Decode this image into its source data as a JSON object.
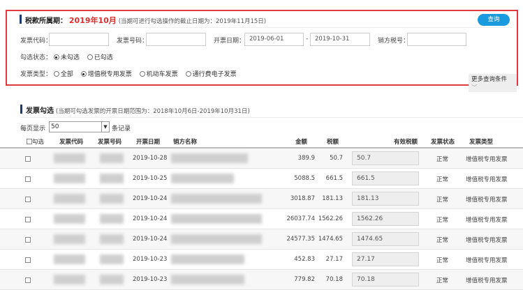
{
  "query_panel": {
    "title": "税款所属期：",
    "period": "2019年10月",
    "deadline_note": "(当期可进行勾选操作的截止日期为：2019年11月15日)",
    "query_button": "查询",
    "invoice_code_label": "发票代码：",
    "invoice_code_value": "",
    "invoice_number_label": "发票号码：",
    "invoice_number_value": "",
    "issue_date_label": "开票日期：",
    "date_from": "2019-06-01",
    "date_sep": "-",
    "date_to": "2019-10-31",
    "seller_tax_id_label": "销方税号：",
    "seller_tax_id_value": "",
    "check_status_label": "勾选状态：",
    "check_status_options": [
      "未勾选",
      "已勾选"
    ],
    "check_status_selected": "未勾选",
    "invoice_type_label": "发票类型：",
    "invoice_type_options": [
      "全部",
      "增值税专用发票",
      "机动车发票",
      "通行费电子发票"
    ],
    "invoice_type_selected": "增值税专用发票",
    "more_conditions": "更多查询条件"
  },
  "list_section": {
    "title": "发票勾选",
    "range_note": "(当期可勾选发票的开票日期范围为：2018年10月6日-2019年10月31日)",
    "page_size_prefix": "每页显示",
    "page_size": "50",
    "page_size_suffix": "条记录",
    "columns": [
      "勾选",
      "发票代码",
      "发票号码",
      "开票日期",
      "销方名称",
      "金额",
      "税额",
      "有效税额",
      "发票状态",
      "发票类型"
    ],
    "rows": [
      {
        "date": "2019-10-28",
        "amount": "389.9",
        "tax": "50.7",
        "effective_tax": "50.7",
        "status": "正常",
        "type": "增值税专用发票"
      },
      {
        "date": "2019-10-25",
        "amount": "5088.5",
        "tax": "661.5",
        "effective_tax": "661.5",
        "status": "正常",
        "type": "增值税专用发票"
      },
      {
        "date": "2019-10-24",
        "amount": "3018.87",
        "tax": "181.13",
        "effective_tax": "181.13",
        "status": "正常",
        "type": "增值税专用发票"
      },
      {
        "date": "2019-10-24",
        "amount": "26037.74",
        "tax": "1562.26",
        "effective_tax": "1562.26",
        "status": "正常",
        "type": "增值税专用发票"
      },
      {
        "date": "2019-10-24",
        "amount": "24577.35",
        "tax": "1474.65",
        "effective_tax": "1474.65",
        "status": "正常",
        "type": "增值税专用发票"
      },
      {
        "date": "2019-10-23",
        "amount": "452.83",
        "tax": "27.17",
        "effective_tax": "27.17",
        "status": "正常",
        "type": "增值税专用发票"
      },
      {
        "date": "2019-10-23",
        "amount": "779.82",
        "tax": "70.18",
        "effective_tax": "70.18",
        "status": "正常",
        "type": "增值税专用发票"
      }
    ]
  },
  "colors": {
    "accent": "#1a9be0",
    "highlight_border": "#e0393e",
    "period": "#d9302f"
  }
}
